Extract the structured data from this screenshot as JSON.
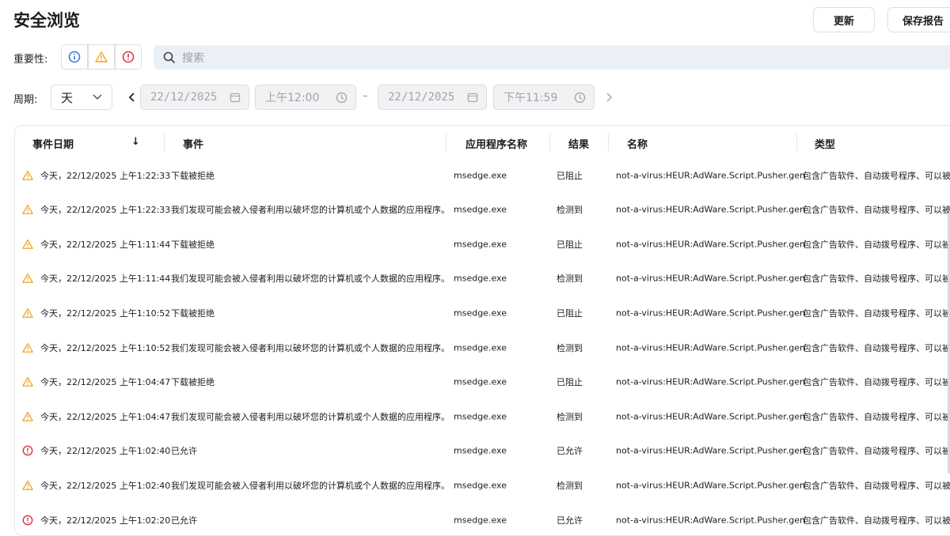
{
  "header": {
    "title": "安全浏览",
    "refresh_label": "更新",
    "save_report_label": "保存报告"
  },
  "filters": {
    "severity_label": "重要性:",
    "search_placeholder": "搜索",
    "period_label": "周期:",
    "period_value": "天",
    "start_date": "22/12/2025",
    "start_time": "上午12:00",
    "end_date": "22/12/2025",
    "end_time": "下午11:59",
    "range_sep": "–"
  },
  "colors": {
    "info": "#3b6fe0",
    "warning": "#f5a623",
    "critical": "#e0313b"
  },
  "table": {
    "columns": [
      "事件日期",
      "事件",
      "应用程序名称",
      "结果",
      "名称",
      "类型"
    ],
    "sort_indicator": "↓",
    "rows": [
      {
        "severity": "warning",
        "date": "今天，22/12/2025 上午1:22:33",
        "event": "下载被拒绝",
        "app": "msedge.exe",
        "result": "已阻止",
        "name": "not-a-virus:HEUR:AdWare.Script.Pusher.gen",
        "type": "包含广告软件、自动拨号程序、可以被"
      },
      {
        "severity": "warning",
        "date": "今天，22/12/2025 上午1:22:33",
        "event": "我们发现可能会被入侵者利用以破坏您的计算机或个人数据的应用程序。",
        "app": "msedge.exe",
        "result": "检测到",
        "name": "not-a-virus:HEUR:AdWare.Script.Pusher.gen",
        "type": "包含广告软件、自动拨号程序、可以被"
      },
      {
        "severity": "warning",
        "date": "今天，22/12/2025 上午1:11:44",
        "event": "下载被拒绝",
        "app": "msedge.exe",
        "result": "已阻止",
        "name": "not-a-virus:HEUR:AdWare.Script.Pusher.gen",
        "type": "包含广告软件、自动拨号程序、可以被"
      },
      {
        "severity": "warning",
        "date": "今天，22/12/2025 上午1:11:44",
        "event": "我们发现可能会被入侵者利用以破坏您的计算机或个人数据的应用程序。",
        "app": "msedge.exe",
        "result": "检测到",
        "name": "not-a-virus:HEUR:AdWare.Script.Pusher.gen",
        "type": "包含广告软件、自动拨号程序、可以被"
      },
      {
        "severity": "warning",
        "date": "今天，22/12/2025 上午1:10:52",
        "event": "下载被拒绝",
        "app": "msedge.exe",
        "result": "已阻止",
        "name": "not-a-virus:HEUR:AdWare.Script.Pusher.gen",
        "type": "包含广告软件、自动拨号程序、可以被"
      },
      {
        "severity": "warning",
        "date": "今天，22/12/2025 上午1:10:52",
        "event": "我们发现可能会被入侵者利用以破坏您的计算机或个人数据的应用程序。",
        "app": "msedge.exe",
        "result": "检测到",
        "name": "not-a-virus:HEUR:AdWare.Script.Pusher.gen",
        "type": "包含广告软件、自动拨号程序、可以被"
      },
      {
        "severity": "warning",
        "date": "今天，22/12/2025 上午1:04:47",
        "event": "下载被拒绝",
        "app": "msedge.exe",
        "result": "已阻止",
        "name": "not-a-virus:HEUR:AdWare.Script.Pusher.gen",
        "type": "包含广告软件、自动拨号程序、可以被"
      },
      {
        "severity": "warning",
        "date": "今天，22/12/2025 上午1:04:47",
        "event": "我们发现可能会被入侵者利用以破坏您的计算机或个人数据的应用程序。",
        "app": "msedge.exe",
        "result": "检测到",
        "name": "not-a-virus:HEUR:AdWare.Script.Pusher.gen",
        "type": "包含广告软件、自动拨号程序、可以被"
      },
      {
        "severity": "critical",
        "date": "今天，22/12/2025 上午1:02:40",
        "event": "已允许",
        "app": "msedge.exe",
        "result": "已允许",
        "name": "not-a-virus:HEUR:AdWare.Script.Pusher.gen",
        "type": "包含广告软件、自动拨号程序、可以被"
      },
      {
        "severity": "warning",
        "date": "今天，22/12/2025 上午1:02:40",
        "event": "我们发现可能会被入侵者利用以破坏您的计算机或个人数据的应用程序。",
        "app": "msedge.exe",
        "result": "检测到",
        "name": "not-a-virus:HEUR:AdWare.Script.Pusher.gen",
        "type": "包含广告软件、自动拨号程序、可以被"
      },
      {
        "severity": "critical",
        "date": "今天，22/12/2025 上午1:02:20",
        "event": "已允许",
        "app": "msedge.exe",
        "result": "已允许",
        "name": "not-a-virus:HEUR:AdWare.Script.Pusher.gen",
        "type": "包含广告软件、自动拨号程序、可以被"
      }
    ]
  }
}
